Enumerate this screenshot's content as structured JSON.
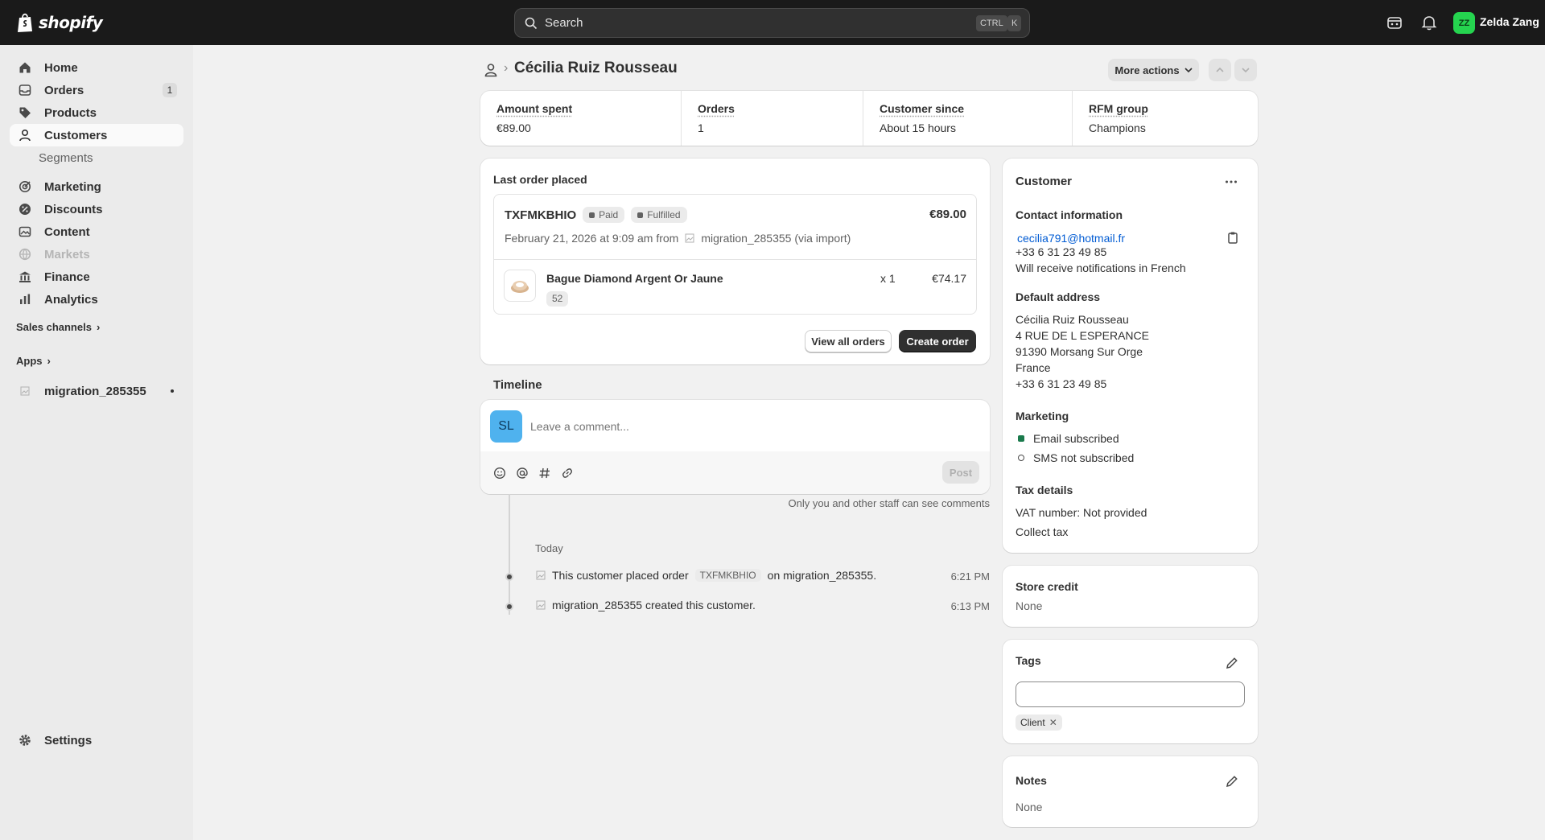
{
  "topbar": {
    "brand": "shopify",
    "search_placeholder": "Search",
    "shortcut_ctrl": "CTRL",
    "shortcut_key": "K",
    "user_initials": "ZZ",
    "user_name": "Zelda Zang"
  },
  "sidebar": {
    "items": [
      {
        "label": "Home",
        "icon": "home-icon"
      },
      {
        "label": "Orders",
        "icon": "orders-icon",
        "badge": "1"
      },
      {
        "label": "Products",
        "icon": "tag-icon"
      },
      {
        "label": "Customers",
        "icon": "person-icon"
      },
      {
        "label": "Segments"
      },
      {
        "label": "Marketing",
        "icon": "target-icon"
      },
      {
        "label": "Discounts",
        "icon": "discount-icon"
      },
      {
        "label": "Content",
        "icon": "content-icon"
      },
      {
        "label": "Markets",
        "icon": "globe-icon"
      },
      {
        "label": "Finance",
        "icon": "bank-icon"
      },
      {
        "label": "Analytics",
        "icon": "chart-icon"
      }
    ],
    "sales_channels": "Sales channels",
    "apps": "Apps",
    "app_item": "migration_285355",
    "settings": "Settings"
  },
  "header": {
    "title": "Cécilia Ruiz Rousseau",
    "more_actions": "More actions"
  },
  "stats": [
    {
      "label": "Amount spent",
      "value": "€89.00"
    },
    {
      "label": "Orders",
      "value": "1"
    },
    {
      "label": "Customer since",
      "value": "About 15 hours"
    },
    {
      "label": "RFM group",
      "value": "Champions"
    }
  ],
  "last_order": {
    "section_title": "Last order placed",
    "order_id": "TXFMKBHIO",
    "payment_status": "Paid",
    "fulfillment_status": "Fulfilled",
    "total": "€89.00",
    "date_text": "February 21, 2026 at 9:09 am from",
    "source": "migration_285355 (via import)",
    "item_name": "Bague Diamond Argent Or Jaune",
    "item_variant": "52",
    "item_qty": "x 1",
    "item_price": "€74.17",
    "view_all_label": "View all orders",
    "create_order_label": "Create order"
  },
  "timeline": {
    "title": "Timeline",
    "avatar_initials": "SL",
    "comment_placeholder": "Leave a comment...",
    "post_label": "Post",
    "staff_note": "Only you and other staff can see comments",
    "day_label": "Today",
    "events": [
      {
        "pre": "This customer placed order",
        "order": "TXFMKBHIO",
        "post": "on migration_285355.",
        "time": "6:21 PM"
      },
      {
        "text": "migration_285355 created this customer.",
        "time": "6:13 PM"
      }
    ]
  },
  "customer": {
    "title": "Customer",
    "contact_heading": "Contact information",
    "email": "cecilia791@hotmail.fr",
    "phone": "+33 6 31 23 49 85",
    "language_note": "Will receive notifications in French",
    "address_heading": "Default address",
    "address_lines": [
      "Cécilia Ruiz Rousseau",
      "4 RUE DE L ESPERANCE",
      "91390 Morsang Sur Orge",
      "France",
      "+33 6 31 23 49 85"
    ],
    "marketing_heading": "Marketing",
    "email_marketing": "Email subscribed",
    "sms_marketing": "SMS not subscribed",
    "tax_heading": "Tax details",
    "vat": "VAT number: Not provided",
    "collect_tax": "Collect tax"
  },
  "store_credit": {
    "title": "Store credit",
    "value": "None"
  },
  "tags": {
    "title": "Tags",
    "input_value": "",
    "chips": [
      "Client"
    ]
  },
  "notes": {
    "title": "Notes",
    "value": "None"
  },
  "colors": {
    "topbar": "#1a1a1a",
    "accent_green": "#25d44f",
    "link": "#005bd3",
    "subscribed": "#1a7a4c",
    "avatar_blue": "#4fb2ee"
  }
}
